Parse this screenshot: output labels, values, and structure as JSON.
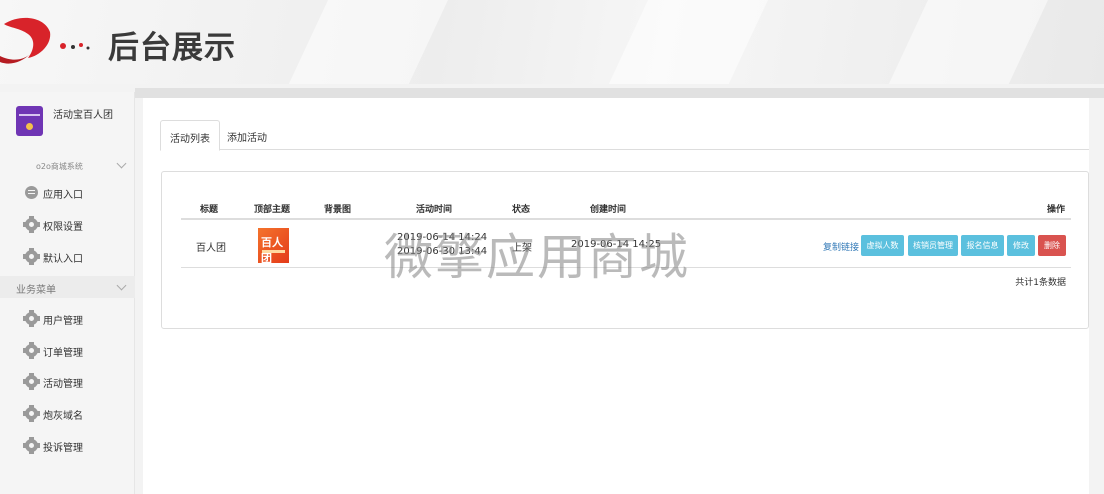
{
  "banner": {
    "title": "后台展示"
  },
  "sidebar": {
    "app_name": "活动宝百人团",
    "system_label": "o2o商城系统",
    "top_items": [
      {
        "label": "应用入口",
        "icon": "chat-bubble-icon"
      },
      {
        "label": "权限设置",
        "icon": "gear-icon"
      },
      {
        "label": "默认入口",
        "icon": "gear-icon"
      }
    ],
    "section_label": "业务菜单",
    "business_items": [
      {
        "label": "用户管理",
        "icon": "gear-icon"
      },
      {
        "label": "订单管理",
        "icon": "gear-icon"
      },
      {
        "label": "活动管理",
        "icon": "gear-icon"
      },
      {
        "label": "炮灰域名",
        "icon": "gear-icon"
      },
      {
        "label": "投诉管理",
        "icon": "gear-icon"
      }
    ]
  },
  "tabs": [
    {
      "label": "活动列表",
      "active": true
    },
    {
      "label": "添加活动",
      "active": false
    }
  ],
  "table": {
    "headers": [
      "标题",
      "顶部主题",
      "背景图",
      "活动时间",
      "状态",
      "创建时间",
      "操作"
    ],
    "rows": [
      {
        "title": "百人团",
        "thumb_text": "百人团",
        "time_start": "2019-06-14 14:24",
        "time_end": "2019-06-30 13:44",
        "status": "上架",
        "created": "2019-06-14 14:25",
        "copy_link": "复制链接",
        "actions": [
          "虚拟人数",
          "核销员管理",
          "报名信息",
          "修改",
          "删除"
        ]
      }
    ],
    "summary": "共计1条数据"
  },
  "watermark": "微擎应用商城",
  "colors": {
    "info": "#5bc0de",
    "danger": "#d9534f",
    "link": "#337ab7",
    "brand": "#d8232a"
  }
}
